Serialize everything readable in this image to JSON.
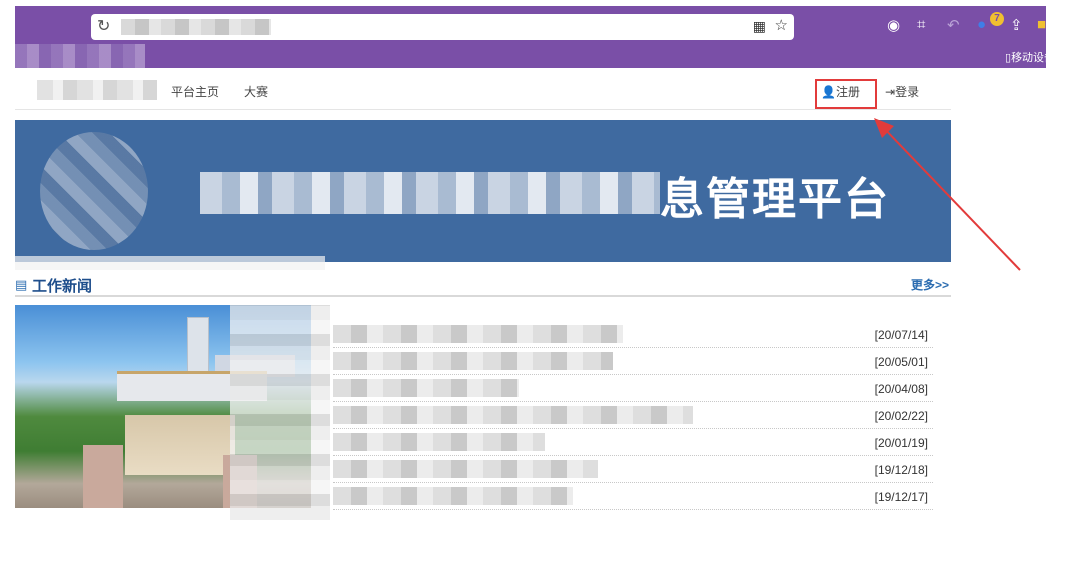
{
  "browser": {
    "mobile_device_label": "移动设备",
    "badge_count": "7"
  },
  "nav": {
    "links": [
      "平台主页",
      "大赛"
    ],
    "register_label": "注册",
    "login_label": "登录"
  },
  "banner": {
    "title_visible": "息管理平台"
  },
  "news": {
    "section_title": "工作新闻",
    "more_label": "更多>>",
    "items": [
      {
        "date": "[20/07/14]"
      },
      {
        "date": "[20/05/01]"
      },
      {
        "date": "[20/04/08]"
      },
      {
        "date": "[20/02/22]"
      },
      {
        "date": "[20/01/19]"
      },
      {
        "date": "[19/12/18]"
      },
      {
        "date": "[19/12/17]"
      }
    ]
  },
  "colors": {
    "chrome": "#7a4fa7",
    "banner": "#3f6aa0",
    "highlight": "#e23b3b",
    "link": "#1e4e8c"
  }
}
